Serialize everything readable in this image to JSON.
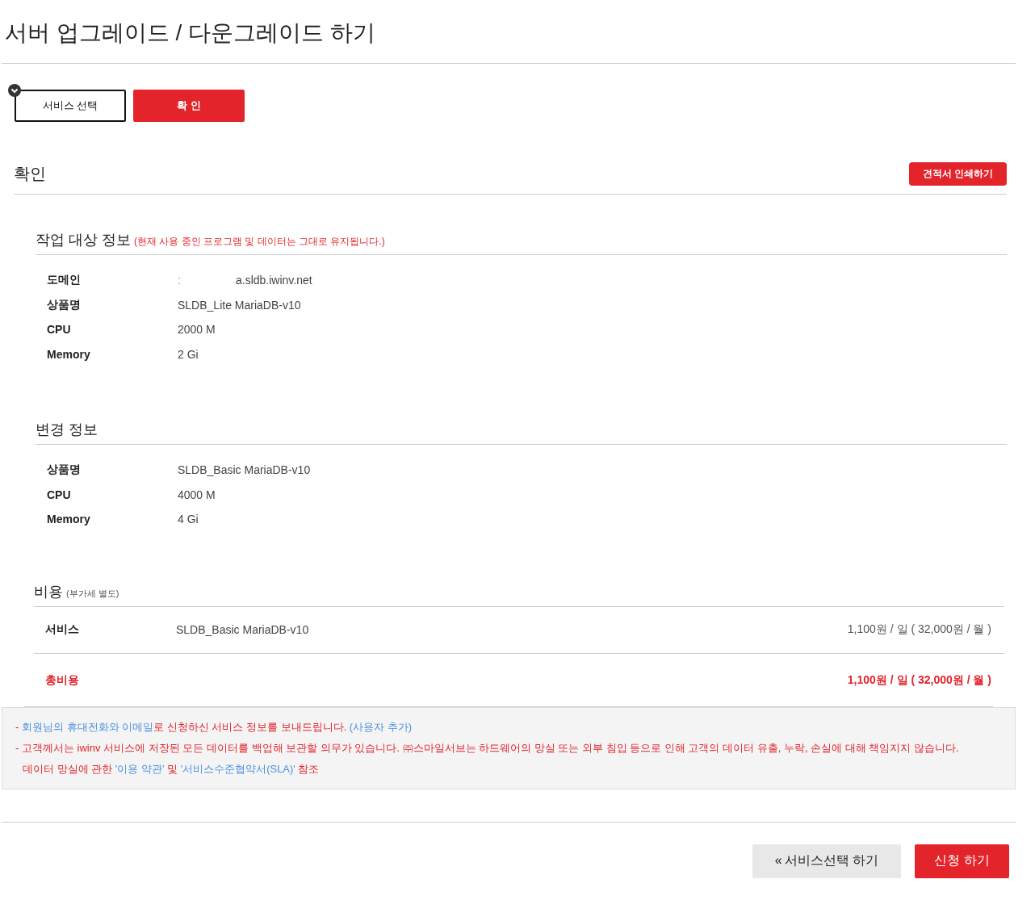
{
  "title": "서버 업그레이드 / 다운그레이드 하기",
  "steps": [
    {
      "label": "서비스 선택",
      "selected": false,
      "completed": true
    },
    {
      "label": "확 인",
      "selected": true,
      "completed": false
    }
  ],
  "section": {
    "title": "확인",
    "print_button": "견적서 인쇄하기"
  },
  "target_info": {
    "title": "작업 대상 정보",
    "note": "(현재 사용 중인 프로그램 및 데이터는 그대로 유지됩니다.)",
    "domain": {
      "label": "도메인",
      "fragment": "ː",
      "value": "a.sldb.iwinv.net"
    },
    "rows": [
      {
        "label": "상품명",
        "value": "SLDB_Lite MariaDB-v10"
      },
      {
        "label": "CPU",
        "value": "2000 M"
      },
      {
        "label": "Memory",
        "value": "2 Gi"
      }
    ]
  },
  "change_info": {
    "title": "변경 정보",
    "rows": [
      {
        "label": "상품명",
        "value": "SLDB_Basic MariaDB-v10"
      },
      {
        "label": "CPU",
        "value": "4000 M"
      },
      {
        "label": "Memory",
        "value": "4 Gi"
      }
    ]
  },
  "cost": {
    "title": "비용",
    "note": "(부가세 별도)",
    "service": {
      "label": "서비스",
      "product": "SLDB_Basic MariaDB-v10",
      "price": "1,100원 / 일 ( 32,000원 / 월 )"
    },
    "total": {
      "label": "총비용",
      "price": "1,100원 / 일 ( 32,000원 / 월 )"
    }
  },
  "notice": [
    [
      {
        "kind": "text",
        "text": "- "
      },
      {
        "kind": "highlight",
        "text": "회원님의 휴대전화와 이메일"
      },
      {
        "kind": "text",
        "text": "로 신청하신 서비스 정보를 보내드립니다. "
      },
      {
        "kind": "link",
        "text": "(사용자 추가)"
      }
    ],
    [
      {
        "kind": "text",
        "text": "- 고객께서는 iwinv 서비스에 저장된 모든 데이터를 백업해 보관할 의무가 있습니다. ㈜스마일서브는 하드웨어의 망실 또는 외부 침입 등으로 인해 고객의 데이터 유출, 누락, 손실에 대해 책임지지 않습니다."
      }
    ],
    [
      {
        "kind": "text",
        "text": "데이터 망실에 관한 "
      },
      {
        "kind": "link",
        "text": "'이용 약관'"
      },
      {
        "kind": "text",
        "text": " 및 "
      },
      {
        "kind": "link",
        "text": "'서비스수준협약서(SLA)'"
      },
      {
        "kind": "text",
        "text": " 참조"
      }
    ]
  ],
  "buttons": {
    "back": {
      "icon": "«",
      "label": "서비스선택 하기"
    },
    "submit": "신청 하기"
  }
}
